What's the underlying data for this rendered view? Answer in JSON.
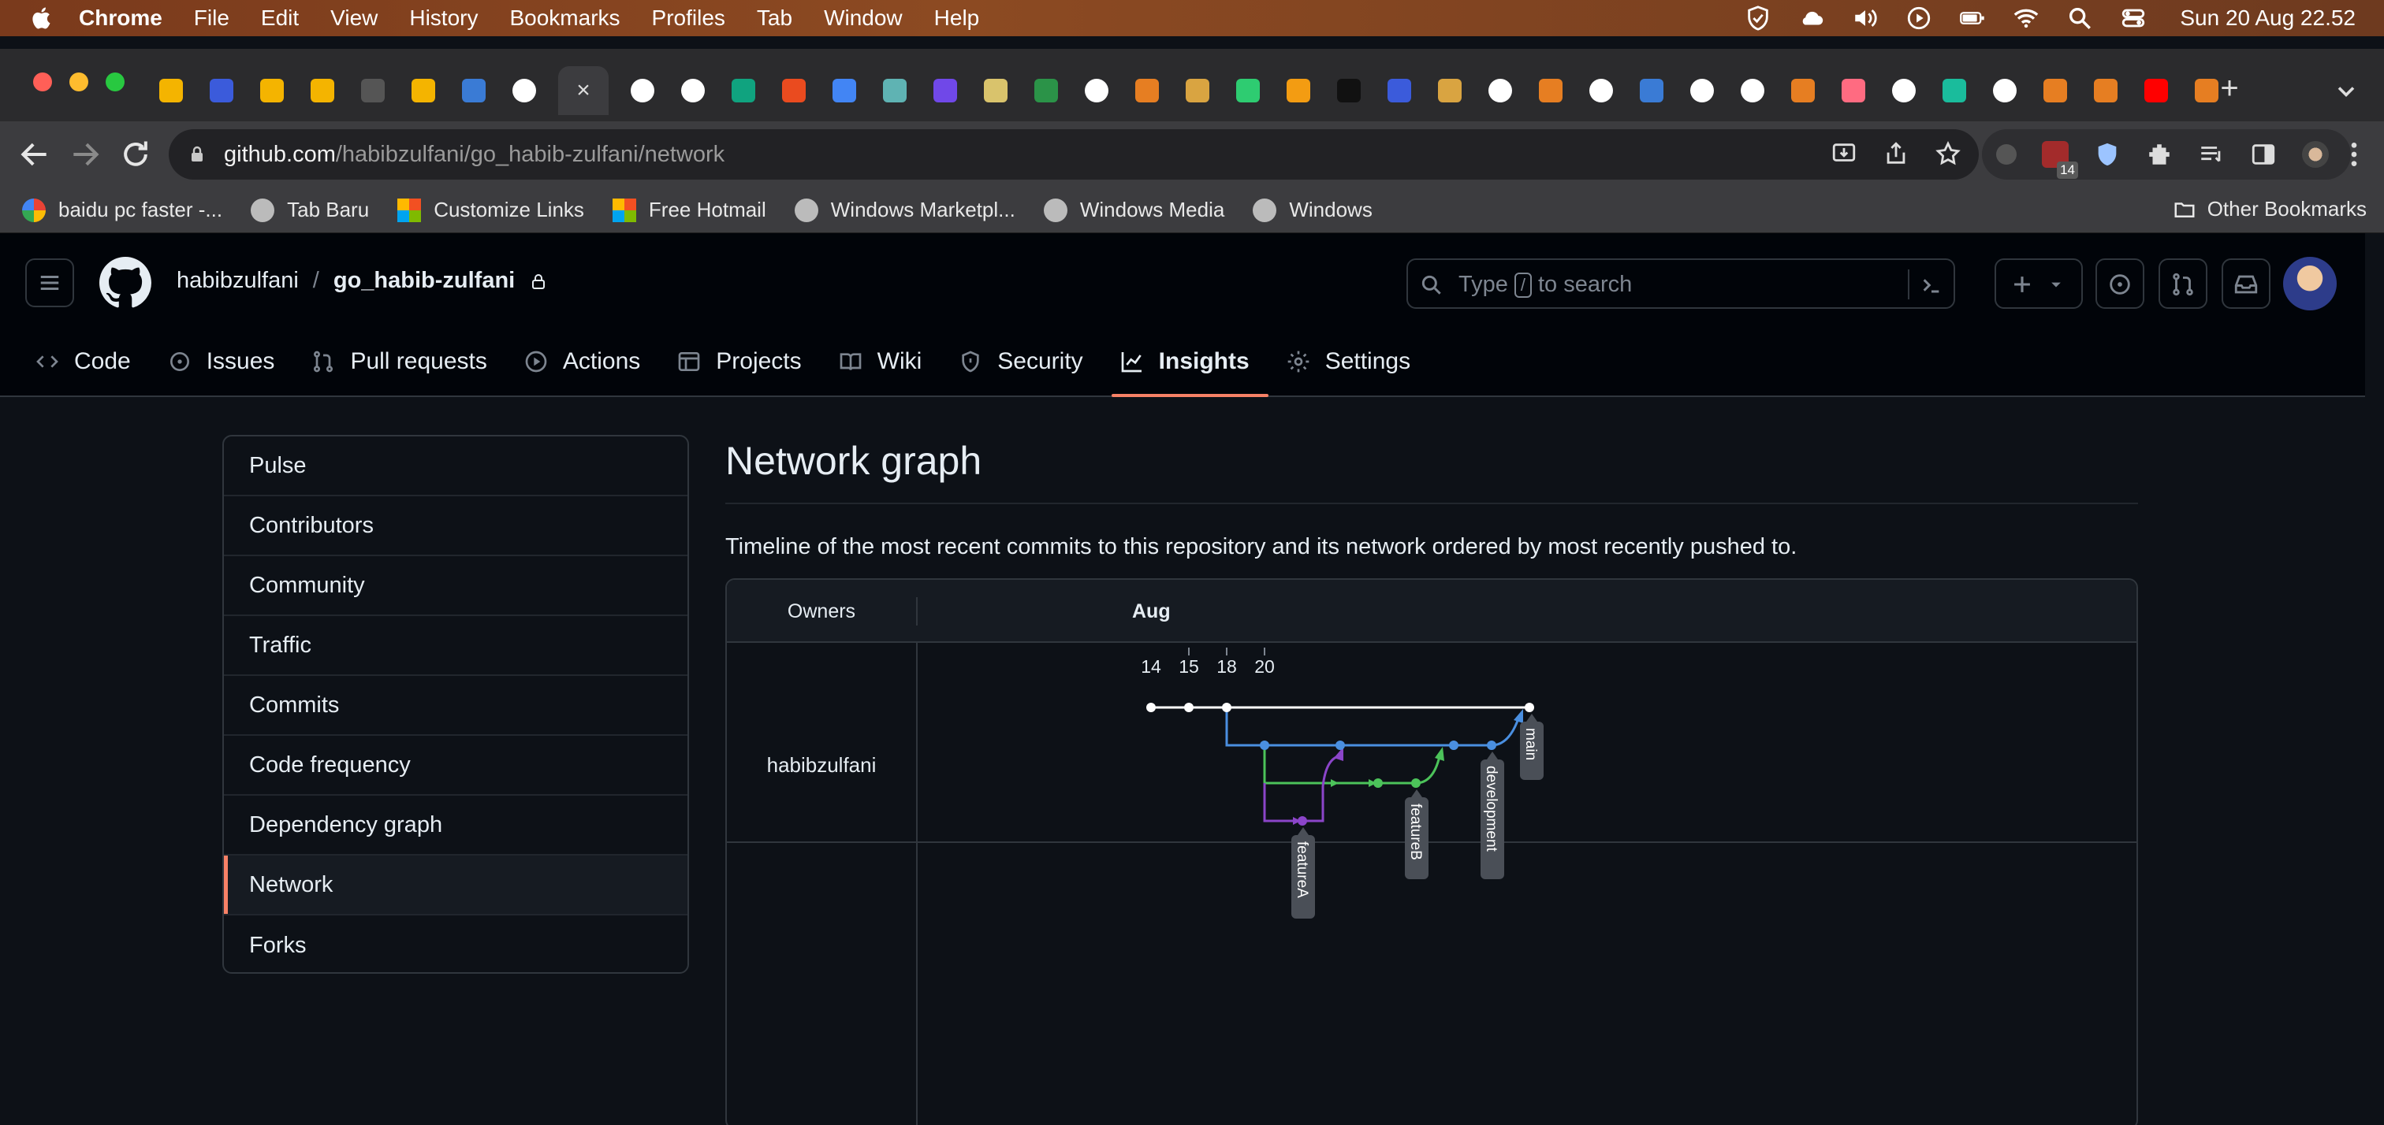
{
  "menubar": {
    "app": "Chrome",
    "items": [
      "File",
      "Edit",
      "View",
      "History",
      "Bookmarks",
      "Profiles",
      "Tab",
      "Window",
      "Help"
    ],
    "clock": "Sun 20 Aug  22.52",
    "status_icons": [
      "vpn-shield-icon",
      "cloud-icon",
      "volume-icon",
      "play-icon",
      "battery-icon",
      "wifi-icon",
      "spotlight-icon",
      "control-center-icon"
    ]
  },
  "browser": {
    "url_host": "github.com",
    "url_path": "/habibzulfani/go_habib-zulfani/network",
    "extension_badge": "14",
    "bookmarks": [
      {
        "label": "baidu pc faster -...",
        "icon": "google-icon"
      },
      {
        "label": "Tab Baru",
        "icon": "globe-icon"
      },
      {
        "label": "Customize Links",
        "icon": "microsoft-icon"
      },
      {
        "label": "Free Hotmail",
        "icon": "microsoft-icon"
      },
      {
        "label": "Windows Marketpl...",
        "icon": "globe-icon"
      },
      {
        "label": "Windows Media",
        "icon": "globe-icon"
      },
      {
        "label": "Windows",
        "icon": "globe-icon"
      }
    ],
    "other_bookmarks": "Other Bookmarks"
  },
  "github": {
    "owner": "habibzulfani",
    "separator": "/",
    "repo": "go_habib-zulfani",
    "search_prefix": "Type",
    "search_key": "/",
    "search_suffix": "to search",
    "repo_tabs": [
      {
        "label": "Code",
        "icon": "code-icon"
      },
      {
        "label": "Issues",
        "icon": "issue-icon"
      },
      {
        "label": "Pull requests",
        "icon": "pull-request-icon"
      },
      {
        "label": "Actions",
        "icon": "play-circle-icon"
      },
      {
        "label": "Projects",
        "icon": "table-icon"
      },
      {
        "label": "Wiki",
        "icon": "book-icon"
      },
      {
        "label": "Security",
        "icon": "shield-icon"
      },
      {
        "label": "Insights",
        "icon": "graph-icon",
        "active": true
      },
      {
        "label": "Settings",
        "icon": "gear-icon"
      }
    ]
  },
  "sidebar": {
    "items": [
      "Pulse",
      "Contributors",
      "Community",
      "Traffic",
      "Commits",
      "Code frequency",
      "Dependency graph",
      "Network",
      "Forks"
    ],
    "selected": "Network"
  },
  "main": {
    "title": "Network graph",
    "subtitle": "Timeline of the most recent commits to this repository and its network ordered by most recently pushed to."
  },
  "network": {
    "owners_header": "Owners",
    "month": "Aug",
    "days": [
      "14",
      "15",
      "18",
      "20"
    ],
    "owner": "habibzulfani",
    "branches": [
      {
        "name": "main",
        "color": "#ffffff"
      },
      {
        "name": "development",
        "color": "#4a8fe0"
      },
      {
        "name": "featureB",
        "color": "#4cc35a"
      },
      {
        "name": "featureA",
        "color": "#8b45c9"
      }
    ]
  },
  "colors": {
    "accent": "#f78166",
    "background": "#0d1117",
    "header": "#010409",
    "border": "#30363d",
    "text": "#e6edf3",
    "muted": "#7d8590"
  }
}
